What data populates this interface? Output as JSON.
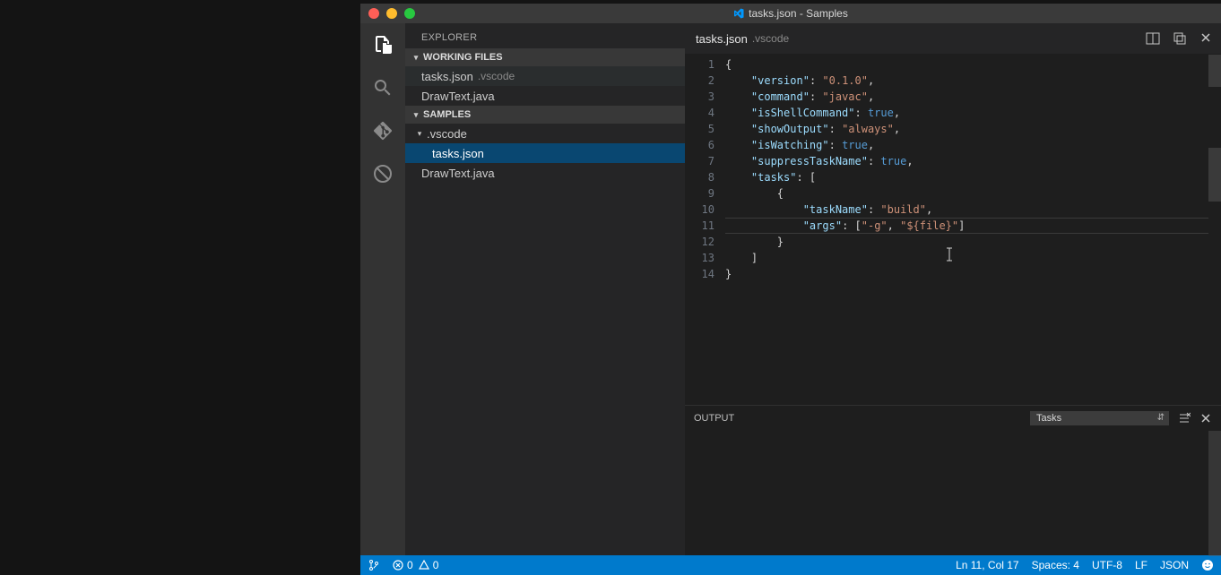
{
  "window": {
    "title": "tasks.json - Samples"
  },
  "sidebar": {
    "title": "EXPLORER",
    "sections": {
      "working": {
        "label": "WORKING FILES",
        "items": [
          {
            "name": "tasks.json",
            "detail": ".vscode"
          },
          {
            "name": "DrawText.java",
            "detail": ""
          }
        ]
      },
      "folder": {
        "label": "SAMPLES",
        "folder_name": ".vscode",
        "items": [
          {
            "name": "tasks.json"
          },
          {
            "name": "DrawText.java"
          }
        ]
      }
    }
  },
  "tab": {
    "name": "tasks.json",
    "detail": ".vscode"
  },
  "editor": {
    "line_numbers": [
      "1",
      "2",
      "3",
      "4",
      "5",
      "6",
      "7",
      "8",
      "9",
      "10",
      "11",
      "12",
      "13",
      "14"
    ],
    "highlight_line_index": 10,
    "lines": [
      [
        {
          "t": "{",
          "c": "p"
        }
      ],
      [
        {
          "t": "    ",
          "c": "p"
        },
        {
          "t": "\"version\"",
          "c": "k"
        },
        {
          "t": ": ",
          "c": "p"
        },
        {
          "t": "\"0.1.0\"",
          "c": "s"
        },
        {
          "t": ",",
          "c": "p"
        }
      ],
      [
        {
          "t": "    ",
          "c": "p"
        },
        {
          "t": "\"command\"",
          "c": "k"
        },
        {
          "t": ": ",
          "c": "p"
        },
        {
          "t": "\"javac\"",
          "c": "s"
        },
        {
          "t": ",",
          "c": "p"
        }
      ],
      [
        {
          "t": "    ",
          "c": "p"
        },
        {
          "t": "\"isShellCommand\"",
          "c": "k"
        },
        {
          "t": ": ",
          "c": "p"
        },
        {
          "t": "true",
          "c": "b"
        },
        {
          "t": ",",
          "c": "p"
        }
      ],
      [
        {
          "t": "    ",
          "c": "p"
        },
        {
          "t": "\"showOutput\"",
          "c": "k"
        },
        {
          "t": ": ",
          "c": "p"
        },
        {
          "t": "\"always\"",
          "c": "s"
        },
        {
          "t": ",",
          "c": "p"
        }
      ],
      [
        {
          "t": "    ",
          "c": "p"
        },
        {
          "t": "\"isWatching\"",
          "c": "k"
        },
        {
          "t": ": ",
          "c": "p"
        },
        {
          "t": "true",
          "c": "b"
        },
        {
          "t": ",",
          "c": "p"
        }
      ],
      [
        {
          "t": "    ",
          "c": "p"
        },
        {
          "t": "\"suppressTaskName\"",
          "c": "k"
        },
        {
          "t": ": ",
          "c": "p"
        },
        {
          "t": "true",
          "c": "b"
        },
        {
          "t": ",",
          "c": "p"
        }
      ],
      [
        {
          "t": "    ",
          "c": "p"
        },
        {
          "t": "\"tasks\"",
          "c": "k"
        },
        {
          "t": ": [",
          "c": "p"
        }
      ],
      [
        {
          "t": "        {",
          "c": "p"
        }
      ],
      [
        {
          "t": "            ",
          "c": "p"
        },
        {
          "t": "\"taskName\"",
          "c": "k"
        },
        {
          "t": ": ",
          "c": "p"
        },
        {
          "t": "\"build\"",
          "c": "s"
        },
        {
          "t": ",",
          "c": "p"
        }
      ],
      [
        {
          "t": "            ",
          "c": "p"
        },
        {
          "t": "\"args\"",
          "c": "k"
        },
        {
          "t": ": [",
          "c": "p"
        },
        {
          "t": "\"-g\"",
          "c": "s"
        },
        {
          "t": ", ",
          "c": "p"
        },
        {
          "t": "\"${file}\"",
          "c": "s"
        },
        {
          "t": "]",
          "c": "p"
        }
      ],
      [
        {
          "t": "        }",
          "c": "p"
        }
      ],
      [
        {
          "t": "    ]",
          "c": "p"
        }
      ],
      [
        {
          "t": "}",
          "c": "p"
        }
      ]
    ]
  },
  "panel": {
    "label": "OUTPUT",
    "select": "Tasks"
  },
  "status": {
    "errors": "0",
    "warnings": "0",
    "position": "Ln 11, Col 17",
    "spaces": "Spaces: 4",
    "encoding": "UTF-8",
    "eol": "LF",
    "language": "JSON"
  }
}
